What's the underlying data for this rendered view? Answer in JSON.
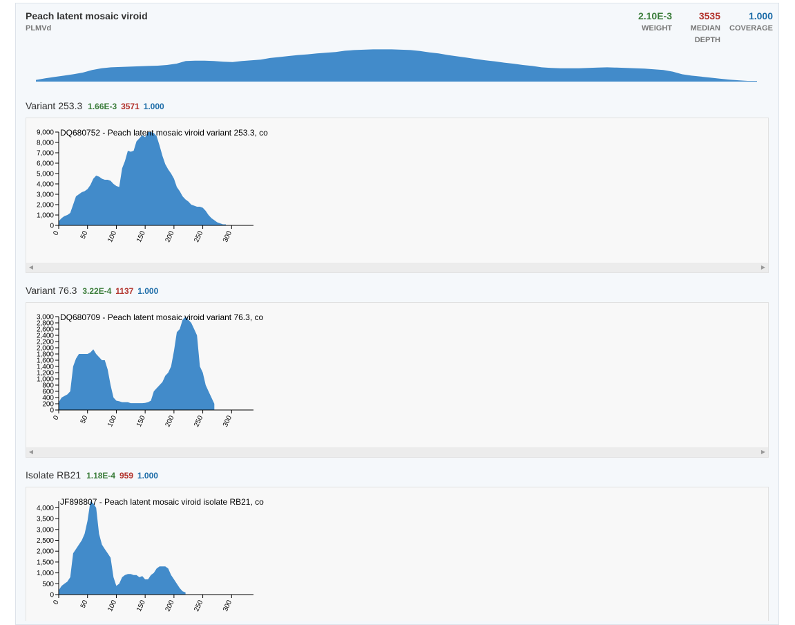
{
  "header": {
    "name": "Peach latent mosaic viroid",
    "abbreviation": "PLMVd",
    "stats": [
      {
        "value": "2.10E-3",
        "label_lines": [
          "WEIGHT"
        ],
        "color": "#3b7d3b"
      },
      {
        "value": "3535",
        "label_lines": [
          "MEDIAN",
          "DEPTH"
        ],
        "color": "#b2322b"
      },
      {
        "value": "1.000",
        "label_lines": [
          "COVERAGE"
        ],
        "color": "#1c6ca8"
      }
    ]
  },
  "overview_coverage": {
    "series_color": "#428bca",
    "relative_depth": [
      0.05,
      0.1,
      0.14,
      0.18,
      0.22,
      0.27,
      0.35,
      0.4,
      0.43,
      0.44,
      0.45,
      0.46,
      0.47,
      0.48,
      0.5,
      0.54,
      0.62,
      0.63,
      0.63,
      0.62,
      0.6,
      0.59,
      0.62,
      0.64,
      0.66,
      0.71,
      0.74,
      0.77,
      0.8,
      0.82,
      0.85,
      0.87,
      0.89,
      0.93,
      0.95,
      0.96,
      0.97,
      0.97,
      0.97,
      0.96,
      0.95,
      0.92,
      0.88,
      0.85,
      0.8,
      0.76,
      0.72,
      0.68,
      0.64,
      0.61,
      0.57,
      0.54,
      0.5,
      0.47,
      0.43,
      0.41,
      0.4,
      0.4,
      0.4,
      0.41,
      0.42,
      0.43,
      0.42,
      0.41,
      0.4,
      0.39,
      0.37,
      0.35,
      0.3,
      0.22,
      0.18,
      0.15,
      0.12,
      0.09,
      0.06,
      0.04,
      0.02,
      0.02
    ]
  },
  "sequences": [
    {
      "title": "Variant 253.3",
      "weight": "1.66E-3",
      "median_depth": "3571",
      "coverage": "1.000",
      "chart_data": {
        "type": "area",
        "title": "DQ680752 - Peach latent mosaic viroid variant 253.3, co",
        "x_ticks": [
          0,
          50,
          100,
          150,
          200,
          250,
          300
        ],
        "y_ticks": [
          0,
          1000,
          2000,
          3000,
          4000,
          5000,
          6000,
          7000,
          8000,
          9000
        ],
        "y_tick_labels": [
          "0",
          "1,000",
          "2,000",
          "3,000",
          "4,000",
          "5,000",
          "6,000",
          "7,000",
          "8,000",
          "9,000"
        ],
        "xlim": [
          0,
          338
        ],
        "ylim": [
          0,
          9000
        ],
        "x": [
          0,
          5,
          10,
          15,
          20,
          25,
          30,
          35,
          40,
          45,
          50,
          55,
          60,
          65,
          70,
          75,
          80,
          85,
          90,
          95,
          100,
          105,
          110,
          115,
          120,
          125,
          130,
          135,
          140,
          145,
          150,
          155,
          160,
          165,
          170,
          175,
          180,
          185,
          190,
          195,
          200,
          205,
          210,
          215,
          220,
          225,
          230,
          235,
          240,
          245,
          250,
          255,
          260,
          265,
          270,
          275,
          280,
          285,
          290,
          295,
          300,
          305,
          310,
          315,
          320,
          325,
          330,
          335,
          338
        ],
        "values": [
          400,
          700,
          900,
          1000,
          1200,
          2000,
          2800,
          3000,
          3200,
          3300,
          3500,
          3900,
          4500,
          4800,
          4700,
          4500,
          4400,
          4400,
          4300,
          4000,
          3800,
          3700,
          5500,
          6200,
          7200,
          7100,
          7200,
          8100,
          8400,
          8700,
          8500,
          9000,
          9000,
          8900,
          8600,
          7700,
          6700,
          5900,
          5400,
          5000,
          4500,
          3700,
          3300,
          2800,
          2500,
          2300,
          2000,
          1900,
          1800,
          1800,
          1700,
          1400,
          1000,
          700,
          500,
          300,
          200,
          100,
          100
        ],
        "xlabel": "",
        "ylabel": "",
        "grid": false
      }
    },
    {
      "title": "Variant 76.3",
      "weight": "3.22E-4",
      "median_depth": "1137",
      "coverage": "1.000",
      "chart_data": {
        "type": "area",
        "title": "DQ680709 - Peach latent mosaic viroid variant 76.3, co",
        "x_ticks": [
          0,
          50,
          100,
          150,
          200,
          250,
          300
        ],
        "y_ticks": [
          0,
          200,
          400,
          600,
          800,
          1000,
          1200,
          1400,
          1600,
          1800,
          2000,
          2200,
          2400,
          2600,
          2800,
          3000
        ],
        "y_tick_labels": [
          "0",
          "200",
          "400",
          "600",
          "800",
          "1,000",
          "1,200",
          "1,400",
          "1,600",
          "1,800",
          "2,000",
          "2,200",
          "2,400",
          "2,600",
          "2,800",
          "3,000"
        ],
        "xlim": [
          0,
          338
        ],
        "ylim": [
          0,
          3000
        ],
        "x": [
          0,
          5,
          10,
          15,
          20,
          25,
          30,
          35,
          40,
          45,
          50,
          55,
          60,
          65,
          70,
          75,
          80,
          85,
          90,
          95,
          100,
          105,
          110,
          115,
          120,
          125,
          130,
          135,
          140,
          145,
          150,
          155,
          160,
          165,
          170,
          175,
          180,
          185,
          190,
          195,
          200,
          205,
          210,
          215,
          220,
          225,
          230,
          235,
          240,
          245,
          250,
          255,
          260,
          265,
          270,
          275,
          280,
          285,
          290,
          295,
          300,
          305,
          310,
          315,
          320,
          325,
          330,
          335,
          338
        ],
        "values": [
          250,
          400,
          450,
          500,
          600,
          1400,
          1650,
          1800,
          1800,
          1800,
          1800,
          1850,
          1950,
          1800,
          1700,
          1600,
          1600,
          1300,
          800,
          400,
          300,
          280,
          250,
          250,
          250,
          220,
          220,
          220,
          220,
          220,
          230,
          250,
          300,
          600,
          700,
          800,
          900,
          1100,
          1200,
          1400,
          1900,
          2500,
          2600,
          2900,
          3000,
          2900,
          2800,
          2600,
          2400,
          1400,
          1200,
          800,
          600,
          400,
          200
        ],
        "xlabel": "",
        "ylabel": "",
        "grid": false
      }
    },
    {
      "title": "Isolate RB21",
      "weight": "1.18E-4",
      "median_depth": "959",
      "coverage": "1.000",
      "chart_data": {
        "type": "area",
        "title": "JF898807 - Peach latent mosaic viroid isolate RB21, co",
        "x_ticks": [
          0,
          50,
          100,
          150,
          200,
          250,
          300
        ],
        "y_ticks": [
          0,
          500,
          1000,
          1500,
          2000,
          2500,
          3000,
          3500,
          4000
        ],
        "y_tick_labels": [
          "0",
          "500",
          "1,000",
          "1,500",
          "2,000",
          "2,500",
          "3,000",
          "3,500",
          "4,000"
        ],
        "xlim": [
          0,
          338
        ],
        "ylim": [
          0,
          4300
        ],
        "x": [
          0,
          5,
          10,
          15,
          20,
          25,
          30,
          35,
          40,
          45,
          50,
          55,
          60,
          65,
          70,
          75,
          80,
          85,
          90,
          95,
          100,
          105,
          110,
          115,
          120,
          125,
          130,
          135,
          140,
          145,
          150,
          155,
          160,
          165,
          170,
          175,
          180,
          185,
          190,
          195,
          200,
          205,
          210,
          215,
          220,
          225,
          230,
          235,
          240,
          245,
          250,
          255,
          260,
          265,
          270,
          275,
          280,
          285,
          290,
          295,
          300,
          305,
          310,
          315,
          320,
          325,
          330,
          335,
          338
        ],
        "values": [
          200,
          400,
          500,
          600,
          800,
          1900,
          2100,
          2300,
          2500,
          2800,
          3400,
          4300,
          4200,
          4000,
          2800,
          2300,
          2100,
          1900,
          1700,
          800,
          400,
          500,
          800,
          900,
          950,
          950,
          900,
          900,
          800,
          850,
          700,
          700,
          900,
          1000,
          1200,
          1300,
          1300,
          1300,
          1200,
          900,
          700,
          500,
          300,
          150,
          100
        ],
        "xlabel": "",
        "ylabel": "",
        "grid": false
      }
    }
  ],
  "colors": {
    "fill": "#428bca",
    "weight": "#3b7d3b",
    "depth": "#b2322b",
    "coverage": "#1c6ca8"
  }
}
